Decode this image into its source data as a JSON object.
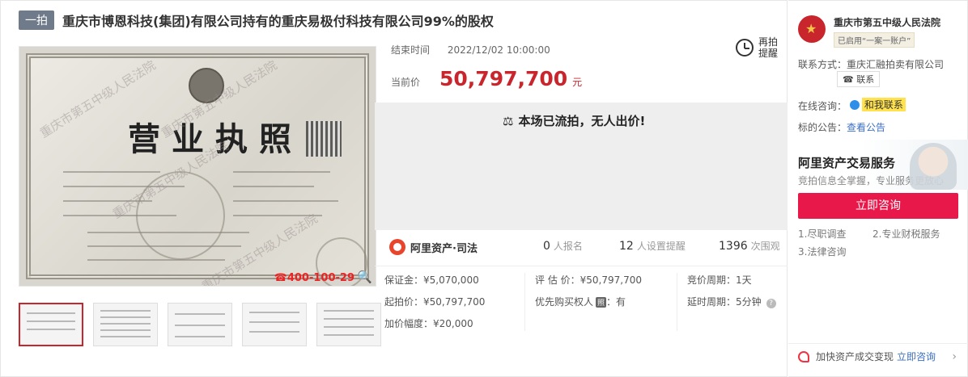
{
  "header": {
    "badge": "一拍",
    "title": "重庆市博恩科技(集团)有限公司持有的重庆易极付科技有限公司99%的股权"
  },
  "gallery": {
    "watermark": "重庆市第五中级人民法院",
    "license_title": "营业执照",
    "phone": "☎400-100-29",
    "thumbnails": 5
  },
  "auction": {
    "end_time_label": "结束时间",
    "end_time": "2022/12/02 10:00:00",
    "current_price_label": "当前价",
    "current_price": "50,797,700",
    "currency_unit": "元",
    "remind_label": "再拍提醒",
    "status_message": "本场已流拍，无人出价!"
  },
  "stats": {
    "platform": "阿里资产·司法",
    "signups": "0",
    "signups_unit": "人报名",
    "reminders": "12",
    "reminders_unit": "人设置提醒",
    "views": "1396",
    "views_unit": "次围观"
  },
  "details": {
    "deposit": "保证金：¥5,070,000",
    "start_price": "起拍价：¥50,797,700",
    "increment": "加价幅度：¥20,000",
    "assessed": "评 估 价：¥50,797,700",
    "priority_label": "优先购买权人",
    "priority_icon": "照",
    "priority_value": "：有",
    "bid_period": "竞价周期：1天",
    "delay_period": "延时周期：5分钟"
  },
  "sidebar": {
    "court_name": "重庆市第五中级人民法院",
    "court_tag": "已启用“一案一账户”",
    "contact_label": "联系方式：",
    "contact_value": "重庆汇融拍卖有限公司",
    "contact_button": "联系",
    "chat_label": "在线咨询：",
    "chat_button": "和我联系",
    "notice_label": "标的公告：",
    "notice_link": "查看公告",
    "banner_title": "阿里资产交易服务",
    "banner_sub": "竞拍信息全掌握，专业服务更放心",
    "consult_button": "立即咨询",
    "services": [
      "1.尽职调查",
      "2.专业财税服务",
      "3.法律咨询"
    ],
    "footer_text": "加快资产成交变现",
    "footer_link": "立即咨询"
  },
  "colors": {
    "accent_red": "#c9252c",
    "consult_pink": "#e8184b",
    "link_blue": "#3b6fc4"
  }
}
